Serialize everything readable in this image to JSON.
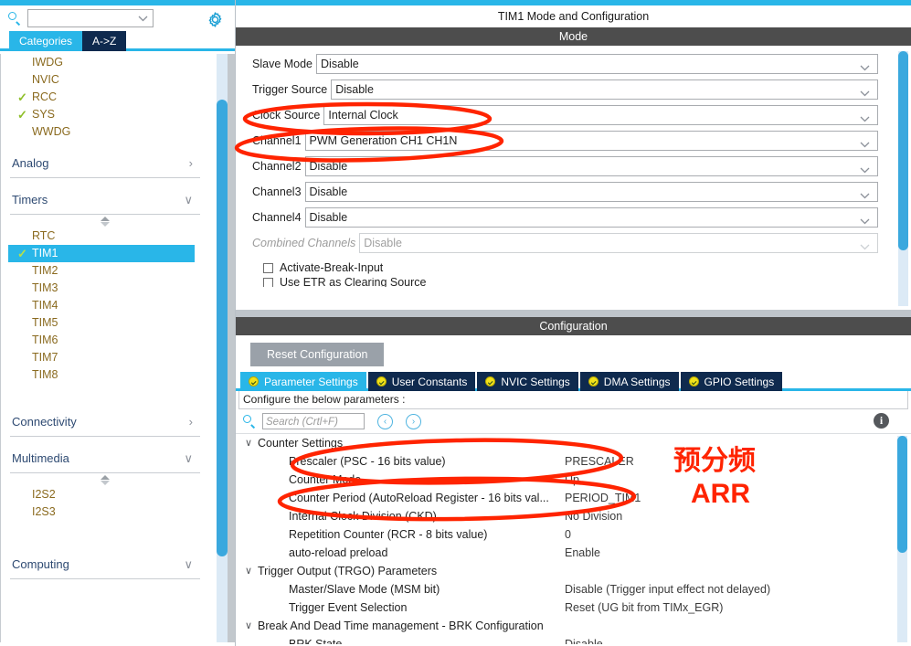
{
  "left_panel": {
    "search": {
      "value": "",
      "placeholder": ""
    },
    "gear_tooltip": "settings",
    "tabs": [
      {
        "label": "Categories",
        "active": true
      },
      {
        "label": "A->Z",
        "active": false
      }
    ],
    "top_items": [
      {
        "label": "IWDG",
        "checked": false
      },
      {
        "label": "NVIC",
        "checked": false
      },
      {
        "label": "RCC",
        "checked": true
      },
      {
        "label": "SYS",
        "checked": true
      },
      {
        "label": "WWDG",
        "checked": false
      }
    ],
    "groups": [
      {
        "label": "Analog",
        "expanded": false,
        "chevron": "›"
      },
      {
        "label": "Timers",
        "expanded": true,
        "chevron": "∨"
      },
      {
        "label": "Connectivity",
        "expanded": false,
        "chevron": "›"
      },
      {
        "label": "Multimedia",
        "expanded": true,
        "chevron": "∨"
      },
      {
        "label": "Computing",
        "expanded": true,
        "chevron": "∨"
      }
    ],
    "timers_items": [
      {
        "label": "RTC",
        "checked": false,
        "selected": false
      },
      {
        "label": "TIM1",
        "checked": true,
        "selected": true
      },
      {
        "label": "TIM2",
        "checked": false,
        "selected": false
      },
      {
        "label": "TIM3",
        "checked": false,
        "selected": false
      },
      {
        "label": "TIM4",
        "checked": false,
        "selected": false
      },
      {
        "label": "TIM5",
        "checked": false,
        "selected": false
      },
      {
        "label": "TIM6",
        "checked": false,
        "selected": false
      },
      {
        "label": "TIM7",
        "checked": false,
        "selected": false
      },
      {
        "label": "TIM8",
        "checked": false,
        "selected": false
      }
    ],
    "multimedia_items": [
      {
        "label": "I2S2",
        "checked": false,
        "selected": false
      },
      {
        "label": "I2S3",
        "checked": false,
        "selected": false
      }
    ]
  },
  "right_panel": {
    "title": "TIM1 Mode and Configuration",
    "mode_header": "Mode",
    "configuration_header": "Configuration",
    "mode_rows": [
      {
        "label": "Slave Mode",
        "value": "Disable",
        "disabled": false
      },
      {
        "label": "Trigger Source",
        "value": "Disable",
        "disabled": false
      },
      {
        "label": "Clock Source",
        "value": "Internal Clock",
        "disabled": false
      },
      {
        "label": "Channel1",
        "value": "PWM Generation CH1 CH1N",
        "disabled": false
      },
      {
        "label": "Channel2",
        "value": "Disable",
        "disabled": false
      },
      {
        "label": "Channel3",
        "value": "Disable",
        "disabled": false
      },
      {
        "label": "Channel4",
        "value": "Disable",
        "disabled": false
      },
      {
        "label": "Combined Channels",
        "value": "Disable",
        "disabled": true
      }
    ],
    "mode_checkboxes": [
      {
        "label": "Activate-Break-Input",
        "checked": false
      },
      {
        "label": "Use ETR as Clearing Source",
        "checked": false
      }
    ],
    "reset_button": "Reset Configuration",
    "config_tabs": [
      {
        "label": "Parameter Settings",
        "active": true
      },
      {
        "label": "User Constants",
        "active": false
      },
      {
        "label": "NVIC Settings",
        "active": false
      },
      {
        "label": "DMA Settings",
        "active": false
      },
      {
        "label": "GPIO Settings",
        "active": false
      }
    ],
    "configure_hint": "Configure the below parameters :",
    "param_search": {
      "value": "",
      "placeholder": "Search (Crtl+F)"
    },
    "nav_prev": "‹",
    "nav_next": "›",
    "param_rows": [
      {
        "type": "group",
        "name": "Counter Settings",
        "value": "",
        "twisty": "∨"
      },
      {
        "type": "item",
        "name": "Prescaler (PSC - 16 bits value)",
        "value": "PRESCALER"
      },
      {
        "type": "item",
        "name": "Counter Mode",
        "value": "Up"
      },
      {
        "type": "item",
        "name": "Counter Period (AutoReload Register - 16 bits val...",
        "value": "PERIOD_TIM1"
      },
      {
        "type": "item",
        "name": "Internal Clock Division (CKD)",
        "value": "No Division"
      },
      {
        "type": "item",
        "name": "Repetition Counter (RCR - 8 bits value)",
        "value": "0"
      },
      {
        "type": "item",
        "name": "auto-reload preload",
        "value": "Enable"
      },
      {
        "type": "group",
        "name": "Trigger Output (TRGO) Parameters",
        "value": "",
        "twisty": "∨"
      },
      {
        "type": "item",
        "name": "Master/Slave Mode (MSM bit)",
        "value": "Disable (Trigger input effect not delayed)"
      },
      {
        "type": "item",
        "name": "Trigger Event Selection",
        "value": "Reset (UG bit from TIMx_EGR)"
      },
      {
        "type": "group",
        "name": "Break And Dead Time management - BRK Configuration",
        "value": "",
        "twisty": "∨"
      },
      {
        "type": "item",
        "name": "BRK State",
        "value": "Disable"
      }
    ]
  },
  "annotations": {
    "prescaler_note": "预分频",
    "arr_note": "ARR",
    "color": "#ff2400"
  },
  "colors": {
    "accent": "#29b6e8",
    "tab_dark": "#0f2a4e",
    "section_bar": "#4d4d4d",
    "selection": "#29b6e8",
    "checkmark_green": "#8fbf2a",
    "item_text": "#8a6a1f",
    "annotation_red": "#ff2400"
  }
}
